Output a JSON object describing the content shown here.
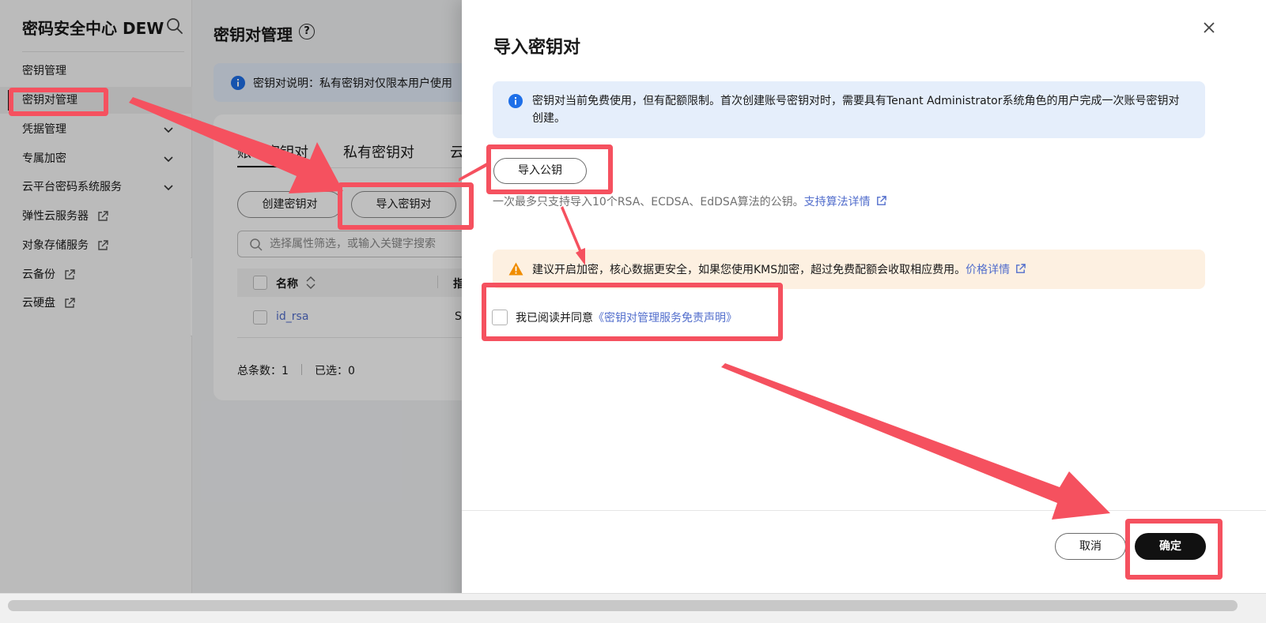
{
  "sidebar": {
    "title": "密码安全中心 DEW",
    "items": [
      {
        "label": "密钥管理"
      },
      {
        "label": "密钥对管理"
      },
      {
        "label": "凭据管理"
      },
      {
        "label": "专属加密"
      },
      {
        "label": "云平台密码系统服务"
      },
      {
        "label": "弹性云服务器"
      },
      {
        "label": "对象存储服务"
      },
      {
        "label": "云备份"
      },
      {
        "label": "云硬盘"
      }
    ]
  },
  "page": {
    "title": "密钥对管理",
    "help": "?",
    "info_text": "密钥对说明：私有密钥对仅限本用户使用",
    "tabs": [
      "账号密钥对",
      "私有密钥对",
      "云"
    ],
    "create_button": "创建密钥对",
    "import_button": "导入密钥对",
    "search_placeholder": "选择属性筛选，或输入关键字搜索",
    "table": {
      "col_name": "名称",
      "col_next": "指",
      "rows": [
        {
          "name": "id_rsa",
          "next": "S"
        }
      ]
    },
    "total_label": "总条数：1",
    "selected_label": "已选：0"
  },
  "drawer": {
    "title": "导入密钥对",
    "info_text": "密钥对当前免费使用，但有配额限制。首次创建账号密钥对时，需要具有Tenant Administrator系统角色的用户完成一次账号密钥对创建。",
    "import_public_key_button": "导入公钥",
    "hint_text": "一次最多只支持导入10个RSA、ECDSA、EdDSA算法的公钥。",
    "hint_link": "支持算法详情",
    "warning_text": "建议开启加密，核心数据更安全，如果您使用KMS加密，超过免费配额会收取相应费用。",
    "warning_link": "价格详情",
    "agree_prefix": "我已阅读并同意",
    "agree_link": "《密钥对管理服务免责声明》",
    "cancel_button": "取消",
    "confirm_button": "确定"
  },
  "colors": {
    "accent_link": "#526ecc",
    "annotation_red": "#f5515f",
    "info_bg": "#e5eefb",
    "warning_bg": "#fdf0e1",
    "warning_icon": "#f08c00",
    "info_icon": "#1e6fe8",
    "primary_button": "#111111"
  },
  "icons": [
    "search-icon",
    "chevron-down-icon",
    "external-link-icon",
    "info-icon",
    "warning-icon",
    "close-icon",
    "sort-icon",
    "help-icon",
    "collapse-left-icon"
  ]
}
